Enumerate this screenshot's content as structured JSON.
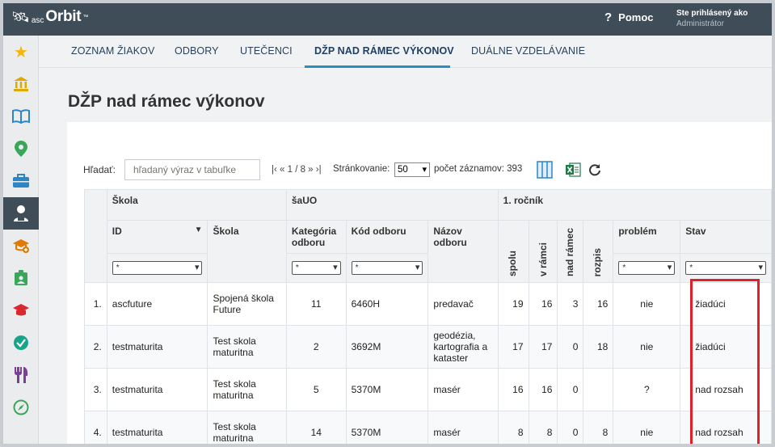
{
  "app": {
    "logo_asc": "asc",
    "logo_orbit": "Orbit",
    "logo_tm": "™",
    "help_label": "Pomoc",
    "user_line1": "Ste prihlásený ako",
    "user_line2": "Administrátor"
  },
  "sidebar": {
    "items": [
      {
        "icon": "star-icon",
        "glyph": "★",
        "color": "#f2b707"
      },
      {
        "icon": "bank-icon",
        "glyph": "🏛",
        "color": "#e0a800"
      },
      {
        "icon": "book-icon",
        "glyph": "📖",
        "color": "#2b86c5"
      },
      {
        "icon": "map-pin-icon",
        "glyph": "📍",
        "color": "#3aa65a"
      },
      {
        "icon": "briefcase-icon",
        "glyph": "💼",
        "color": "#2b86c5"
      },
      {
        "icon": "student-icon",
        "glyph": "👤",
        "color": "#ffffff"
      },
      {
        "icon": "graduation-add-icon",
        "glyph": "🎓",
        "color": "#e07a00"
      },
      {
        "icon": "id-badge-icon",
        "glyph": "🪪",
        "color": "#3aa65a"
      },
      {
        "icon": "graduation-cap-icon",
        "glyph": "🎓",
        "color": "#d9282f"
      },
      {
        "icon": "check-circle-icon",
        "glyph": "✔",
        "color": "#17a589"
      },
      {
        "icon": "cutlery-icon",
        "glyph": "🍴",
        "color": "#7b3f98"
      },
      {
        "icon": "compass-icon",
        "glyph": "🧭",
        "color": "#3aa65a"
      }
    ]
  },
  "tabs": [
    {
      "label": "ZOZNAM ŽIAKOV"
    },
    {
      "label": "ODBORY"
    },
    {
      "label": "UTEČENCI"
    },
    {
      "label": "DŽP NAD RÁMEC VÝKONOV"
    },
    {
      "label": "DUÁLNE VZDELÁVANIE"
    }
  ],
  "page": {
    "title": "DŽP nad rámec výkonov"
  },
  "toolbar": {
    "search_label": "Hľadať:",
    "search_placeholder": "hľadaný výraz v tabuľke",
    "pager": "|‹ « 1 / 8 » ›|",
    "paging_label": "Stránkovanie:",
    "paging_value": "50",
    "records": "počet záznamov: 393"
  },
  "table": {
    "group_headers": {
      "skola": "Škola",
      "sauo": "šaUO",
      "rocnik": "1. ročník"
    },
    "columns": {
      "id": "ID",
      "skola": "Škola",
      "kategoria": "Kategória odboru",
      "kod": "Kód odboru",
      "nazov": "Názov odboru",
      "spolu": "spolu",
      "v_ramci": "v rámci",
      "nad_ramec": "nad rámec",
      "rozpis": "rozpis",
      "problem": "problém",
      "stav": "Stav"
    },
    "filter_value": "*",
    "rows": [
      {
        "n": "1.",
        "id": "ascfuture",
        "skola": "Spojená škola Future",
        "kategoria": "11",
        "kod": "6460H",
        "nazov": "predavač",
        "spolu": "19",
        "v_ramci": "16",
        "nad_ramec": "3",
        "rozpis": "16",
        "problem": "nie",
        "stav": "žiadúci"
      },
      {
        "n": "2.",
        "id": "testmaturita",
        "skola": "Test skola maturitna",
        "kategoria": "2",
        "kod": "3692M",
        "nazov": "geodézia, kartografia a kataster",
        "spolu": "17",
        "v_ramci": "17",
        "nad_ramec": "0",
        "rozpis": "18",
        "problem": "nie",
        "stav": "žiadúci"
      },
      {
        "n": "3.",
        "id": "testmaturita",
        "skola": "Test skola maturitna",
        "kategoria": "5",
        "kod": "5370M",
        "nazov": "masér",
        "spolu": "16",
        "v_ramci": "16",
        "nad_ramec": "0",
        "rozpis": "",
        "problem": "?",
        "stav": "nad rozsah"
      },
      {
        "n": "4.",
        "id": "testmaturita",
        "skola": "Test skola maturitna",
        "kategoria": "14",
        "kod": "5370M",
        "nazov": "masér",
        "spolu": "8",
        "v_ramci": "8",
        "nad_ramec": "0",
        "rozpis": "8",
        "problem": "nie",
        "stav": "nad rozsah"
      }
    ]
  }
}
